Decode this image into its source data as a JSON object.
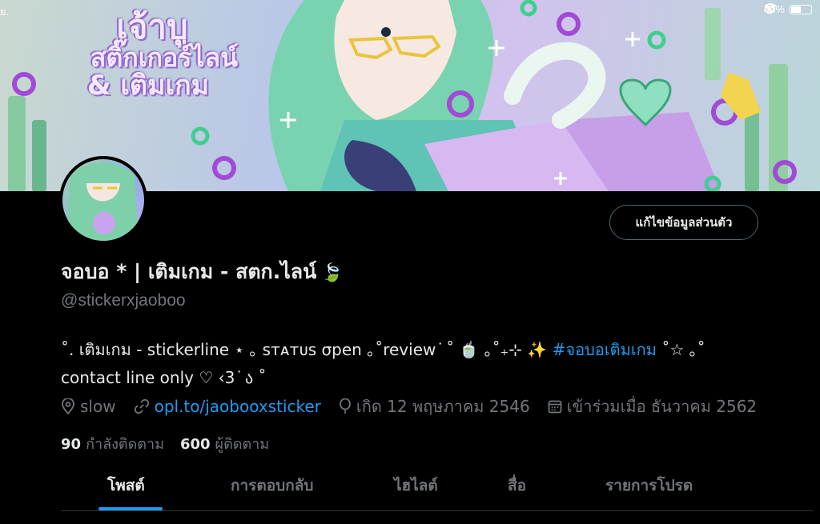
{
  "status_bar": {
    "time": "ย.",
    "battery": "49%"
  },
  "banner": {
    "title_line1": "เจ้าบู",
    "title_line2": "สติ๊กเกอร์ไลน์",
    "title_line3": "& เติมเกม"
  },
  "profile": {
    "edit_button": "แก้ไขข้อมูลส่วนตัว",
    "display_name": "จอบอ * | เติมเกม - สตก.ไลน์",
    "name_emoji": "🍃",
    "handle": "@stickerxjaoboo",
    "bio_line1": "˚. เติมเกม - stickerline ⋆ ｡ ꜱᴛᴀᴛᴜꜱ σpen ｡˚review ͘ ˚ 🍵 ｡˚₊⊹   ✨",
    "bio_hashtag": "#จอบอเติมเกม",
    "bio_line1_end": " ˚☆ ｡˚",
    "bio_line2": "contact line only ♡ ‹3 ͘ ა ˚",
    "location": "slow",
    "link": "opl.to/jaobooxsticker",
    "birthday": "เกิด 12 พฤษภาคม 2546",
    "joined": "เข้าร่วมเมื่อ ธันวาคม 2562",
    "following_count": "90",
    "following_label": "กำลังติดตาม",
    "followers_count": "600",
    "followers_label": "ผู้ติดตาม"
  },
  "tabs": [
    {
      "label": "โพสต์",
      "active": true
    },
    {
      "label": "การตอบกลับ",
      "active": false
    },
    {
      "label": "ไฮไลต์",
      "active": false
    },
    {
      "label": "สื่อ",
      "active": false
    },
    {
      "label": "รายการโปรด",
      "active": false
    }
  ],
  "colors": {
    "accent": "#1d9bf0",
    "muted": "#71767b",
    "text": "#e7e9ea",
    "background": "#000000"
  },
  "icons": [
    "location-pin-icon",
    "link-icon",
    "balloon-icon",
    "calendar-icon",
    "wifi-icon",
    "battery-icon"
  ]
}
